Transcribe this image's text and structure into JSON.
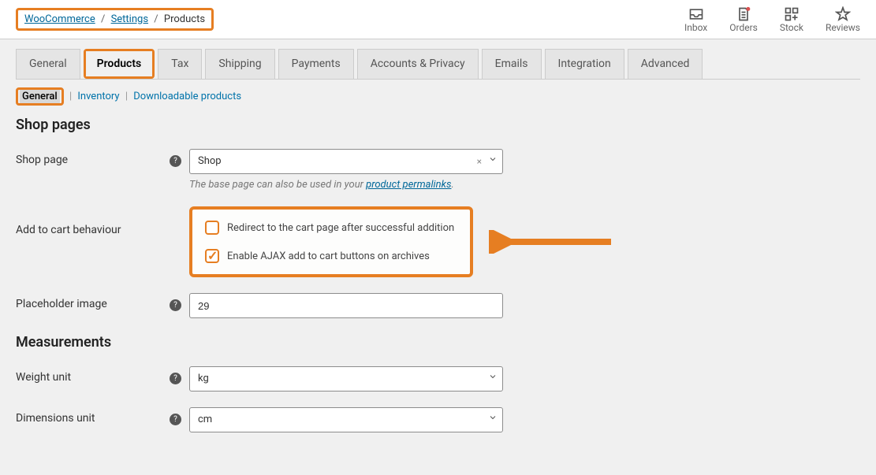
{
  "breadcrumb": {
    "woo": "WooCommerce",
    "settings": "Settings",
    "products": "Products"
  },
  "top_nav": {
    "inbox": "Inbox",
    "orders": "Orders",
    "stock": "Stock",
    "reviews": "Reviews"
  },
  "tabs": {
    "general": "General",
    "products": "Products",
    "tax": "Tax",
    "shipping": "Shipping",
    "payments": "Payments",
    "accounts": "Accounts & Privacy",
    "emails": "Emails",
    "integration": "Integration",
    "advanced": "Advanced"
  },
  "subtabs": {
    "general": "General",
    "inventory": "Inventory",
    "downloadable": "Downloadable products"
  },
  "sections": {
    "shop_pages": "Shop pages",
    "measurements": "Measurements"
  },
  "fields": {
    "shop_page_label": "Shop page",
    "shop_page_value": "Shop",
    "shop_page_desc_pre": "The base page can also be used in your ",
    "shop_page_link": "product permalinks",
    "shop_page_desc_post": ".",
    "add_to_cart_label": "Add to cart behaviour",
    "redirect_label": "Redirect to the cart page after successful addition",
    "ajax_label": "Enable AJAX add to cart buttons on archives",
    "placeholder_label": "Placeholder image",
    "placeholder_value": "29",
    "weight_label": "Weight unit",
    "weight_value": "kg",
    "dimensions_label": "Dimensions unit",
    "dimensions_value": "cm"
  },
  "colors": {
    "highlight": "#e67e22"
  }
}
